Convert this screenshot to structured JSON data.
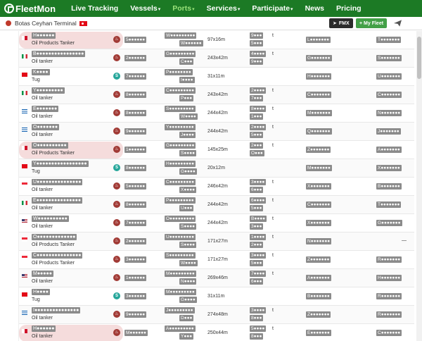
{
  "nav": {
    "logo": "FleetMon",
    "items": [
      {
        "label": "Live Tracking",
        "dropdown": false,
        "active": false
      },
      {
        "label": "Vessels",
        "dropdown": true,
        "active": false
      },
      {
        "label": "Ports",
        "dropdown": true,
        "active": true
      },
      {
        "label": "Services",
        "dropdown": true,
        "active": false
      },
      {
        "label": "Participate",
        "dropdown": true,
        "active": false
      },
      {
        "label": "News",
        "dropdown": false,
        "active": false
      },
      {
        "label": "Pricing",
        "dropdown": false,
        "active": false
      }
    ]
  },
  "subheader": {
    "port_name": "Botas Ceyhan Terminal",
    "fmx_label": "FMX",
    "myfleet_label": "+ My Fleet"
  },
  "colors": {
    "nav_bg": "#1c7a25",
    "active_nav": "#9ae27a",
    "highlight": "#f5dcdc",
    "tanker_icon": "#a13a35",
    "tug_icon": "#26a69a",
    "masked": "#8b8b8b"
  },
  "rows": [
    {
      "flag": "mt",
      "name": "H●●●●●●",
      "type": "Oil Products Tanker",
      "icon": "tanker",
      "icon_text": "♨",
      "highlight": true,
      "a": "5●●●●●●",
      "b1": "W●●●●●●●●●",
      "b2": "W●●●●●●",
      "dims": "97x16m",
      "dw1": "9●●●",
      "dw2": "5●●●",
      "dwt": "t",
      "c": "L●●●●●●●",
      "d": "T●●●●●●●"
    },
    {
      "flag": "it",
      "name": "B●●●●●●●●●●●●●●●●",
      "type": "Oil tanker",
      "icon": "tanker",
      "icon_text": "♨",
      "highlight": false,
      "a": "2●●●●●●",
      "b1": "G●●●●●●●●●",
      "b2": "C●●●",
      "dims": "243x42m",
      "dw1": "4●●●●",
      "dw2": "9●●●",
      "dwt": "t",
      "c": "G●●●●●●●",
      "d": "S●●●●●●●"
    },
    {
      "flag": "tr",
      "name": "K●●●●",
      "type": "Tug",
      "icon": "tug",
      "icon_text": "S",
      "highlight": false,
      "a": "7●●●●●●",
      "b1": "P●●●●●●●●",
      "b2": "I●●●●",
      "dims": "31x11m",
      "dw1": "",
      "dw2": "",
      "dwt": "",
      "c": "H●●●●●●●",
      "d": "U●●●●●●●"
    },
    {
      "flag": "it",
      "name": "Y●●●●●●●●●",
      "type": "Oil tanker",
      "icon": "tanker",
      "icon_text": "♨",
      "highlight": false,
      "a": "8●●●●●●",
      "b1": "C●●●●●●●●●",
      "b2": "P●●●",
      "dims": "243x42m",
      "dw1": "2●●●●",
      "dw2": "7●●●",
      "dwt": "t",
      "c": "C●●●●●●●",
      "d": "C●●●●●●●"
    },
    {
      "flag": "gr",
      "name": "E●●●●●●●",
      "type": "Oil tanker",
      "icon": "tanker",
      "icon_text": "♨",
      "highlight": false,
      "a": "8●●●●●●",
      "b1": "S●●●●●●●●●",
      "b2": "W●●●●",
      "dims": "244x42m",
      "dw1": "8●●●●",
      "dw2": "1●●●",
      "dwt": "t",
      "c": "M●●●●●●●",
      "d": "N●●●●●●●"
    },
    {
      "flag": "gr",
      "name": "O●●●●●●●",
      "type": "Oil tanker",
      "icon": "tanker",
      "icon_text": "♨",
      "highlight": false,
      "a": "9●●●●●●",
      "b1": "Y●●●●●●●●●",
      "b2": "J●●●●",
      "dims": "244x42m",
      "dw1": "2●●●●",
      "dw2": "5●●●",
      "dwt": "t",
      "c": "Q●●●●●●●",
      "d": "J●●●●●●●"
    },
    {
      "flag": "mt",
      "name": "O●●●●●●●●●●",
      "type": "Oil Products Tanker",
      "icon": "tanker",
      "icon_text": "♨",
      "highlight": true,
      "a": "1●●●●●●",
      "b1": "G●●●●●●●●●",
      "b2": "S●●●●",
      "dims": "145x25m",
      "dw1": "2●●●",
      "dw2": "O●●●",
      "dwt": "t",
      "c": "Z●●●●●●●",
      "d": "A●●●●●●●"
    },
    {
      "flag": "tr",
      "name": "Y●●●●●●●●●●●●●●●●●",
      "type": "Tug",
      "icon": "tug",
      "icon_text": "S",
      "highlight": false,
      "a": "8●●●●●●",
      "b1": "H●●●●●●●●●",
      "b2": "G●●●●",
      "dims": "20x12m",
      "dw1": "",
      "dw2": "",
      "dwt": "",
      "c": "M●●●●●●●",
      "d": "X●●●●●●●"
    },
    {
      "flag": "sg",
      "name": "U●●●●●●●●●●●●●●●",
      "type": "Oil tanker",
      "icon": "tanker",
      "icon_text": "♨",
      "highlight": false,
      "a": "5●●●●●●",
      "b1": "C●●●●●●●●●",
      "b2": "X●●●●",
      "dims": "246x42m",
      "dw1": "3●●●●",
      "dw2": "6●●●",
      "dwt": "t",
      "c": "X●●●●●●●",
      "d": "B●●●●●●●"
    },
    {
      "flag": "it",
      "name": "E●●●●●●●●●●●●●●●",
      "type": "Oil tanker",
      "icon": "tanker",
      "icon_text": "♨",
      "highlight": false,
      "a": "8●●●●●●",
      "b1": "P●●●●●●●●●",
      "b2": "U●●●",
      "dims": "244x42m",
      "dw1": "6●●●●",
      "dw2": "5●●●",
      "dwt": "t",
      "c": "C●●●●●●●",
      "d": "T●●●●●●●"
    },
    {
      "flag": "us",
      "name": "W●●●●●●●●●●",
      "type": "Oil tanker",
      "icon": "tanker",
      "icon_text": "♨",
      "highlight": false,
      "a": "7●●●●●●",
      "b1": "O●●●●●●●●●",
      "b2": "S●●●●",
      "dims": "244x42m",
      "dw1": "B●●●●",
      "dw2": "3●●●",
      "dwt": "t",
      "c": "X●●●●●●●",
      "d": "G●●●●●●●"
    },
    {
      "flag": "sg",
      "name": "O●●●●●●●●●●●●●",
      "type": "Oil Products Tanker",
      "icon": "tanker",
      "icon_text": "♨",
      "highlight": false,
      "a": "2●●●●●●",
      "b1": "U●●●●●●●●●",
      "b2": "S●●●●",
      "dims": "171x27m",
      "dw1": "1●●●●",
      "dw2": "2●●●",
      "dwt": "t",
      "c": "N●●●●●●●",
      "d": "",
      "d_text": "—"
    },
    {
      "flag": "sg",
      "name": "C●●●●●●●●●●●●●●●",
      "type": "Oil Products Tanker",
      "icon": "tanker",
      "icon_text": "♨",
      "highlight": false,
      "a": "3●●●●●●",
      "b1": "S●●●●●●●●●",
      "b2": "W●●●●",
      "dims": "171x27m",
      "dw1": "3●●●●",
      "dw2": "5●●●",
      "dwt": "t",
      "c": "Z●●●●●●●",
      "d": "R●●●●●●●"
    },
    {
      "flag": "us",
      "name": "M●●●●●",
      "type": "Oil tanker",
      "icon": "tanker",
      "icon_text": "♨",
      "highlight": false,
      "a": "1●●●●●●",
      "b1": "M●●●●●●●●●",
      "b2": "N●●●●",
      "dims": "269x46m",
      "dw1": "7●●●●",
      "dw2": "6●●●",
      "dwt": "t",
      "c": "A●●●●●●●",
      "d": "H●●●●●●●"
    },
    {
      "flag": "tr",
      "name": "H●●●●",
      "type": "Tug",
      "icon": "tug",
      "icon_text": "S",
      "highlight": false,
      "a": "3●●●●●●",
      "b1": "M●●●●●●●●●",
      "b2": "G●●●●",
      "dims": "31x11m",
      "dw1": "",
      "dw2": "",
      "dwt": "",
      "c": "B●●●●●●●",
      "d": "R●●●●●●●"
    },
    {
      "flag": "gr",
      "name": "I●●●●●●●●●●●●●●●",
      "type": "Oil tanker",
      "icon": "tanker",
      "icon_text": "♨",
      "highlight": false,
      "a": "9●●●●●●",
      "b1": "J●●●●●●●●●",
      "b2": "D●●●",
      "dims": "274x48m",
      "dw1": "3●●●●",
      "dw2": "8●●●",
      "dwt": "t",
      "c": "Z●●●●●●●",
      "d": "R●●●●●●●"
    },
    {
      "flag": "mt",
      "name": "H●●●●●●",
      "type": "Oil tanker",
      "icon": "tanker",
      "icon_text": "♨",
      "highlight": true,
      "a": "M●●●●●●",
      "b1": "A●●●●●●●●●",
      "b2": "Y●●●",
      "dims": "250x44m",
      "dw1": "5●●●●",
      "dw2": "8●●●",
      "dwt": "t",
      "c": "E●●●●●●●",
      "d": "C●●●●●●●"
    }
  ]
}
